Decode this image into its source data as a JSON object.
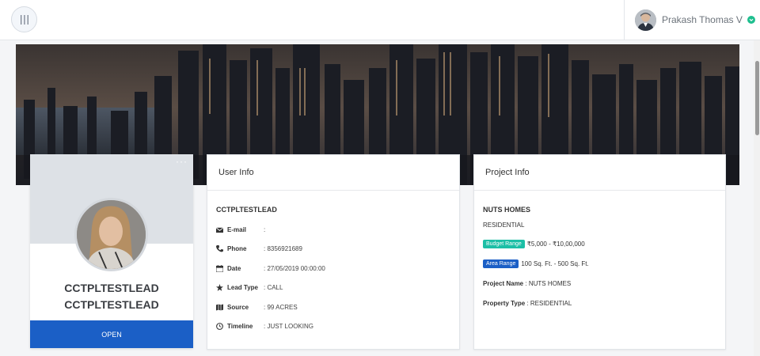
{
  "header": {
    "user_name": "Prakash Thomas V"
  },
  "icons": {
    "menu": "menu-icon",
    "status": "chevron-down-icon"
  },
  "profile": {
    "name": "CCTPLTESTLEAD CCTPLTESTLEAD",
    "button": "OPEN",
    "more": "···"
  },
  "user_info": {
    "title": "User Info",
    "lead_name": "CCTPLTESTLEAD",
    "rows": [
      {
        "icon": "envelope-icon",
        "label": "E-mail",
        "value": ":"
      },
      {
        "icon": "phone-icon",
        "label": "Phone",
        "value": ": 8356921689"
      },
      {
        "icon": "calendar-icon",
        "label": "Date",
        "value": ": 27/05/2019 00:00:00"
      },
      {
        "icon": "star-icon",
        "label": "Lead Type",
        "value": ": CALL"
      },
      {
        "icon": "map-icon",
        "label": "Source",
        "value": ": 99 ACRES"
      },
      {
        "icon": "clock-icon",
        "label": "Timeline",
        "value": ": JUST LOOKING"
      }
    ]
  },
  "project_info": {
    "title": "Project Info",
    "project_name": "NUTS HOMES",
    "property_type": "RESIDENTIAL",
    "budget_badge": "Budget Range",
    "budget_value": "₹5,000 - ₹10,00,000",
    "area_badge": "Area Range",
    "area_value": "100 Sq. Ft. - 500 Sq. Ft.",
    "project_name_label": "Project Name",
    "project_name_value": ": NUTS HOMES",
    "property_type_label": "Property Type",
    "property_type_value": ": RESIDENTIAL"
  },
  "colors": {
    "primary": "#1b5fc6",
    "budget_badge": "#1cbfa6",
    "area_badge": "#1b5fc6",
    "status": "#1fbf8f"
  }
}
